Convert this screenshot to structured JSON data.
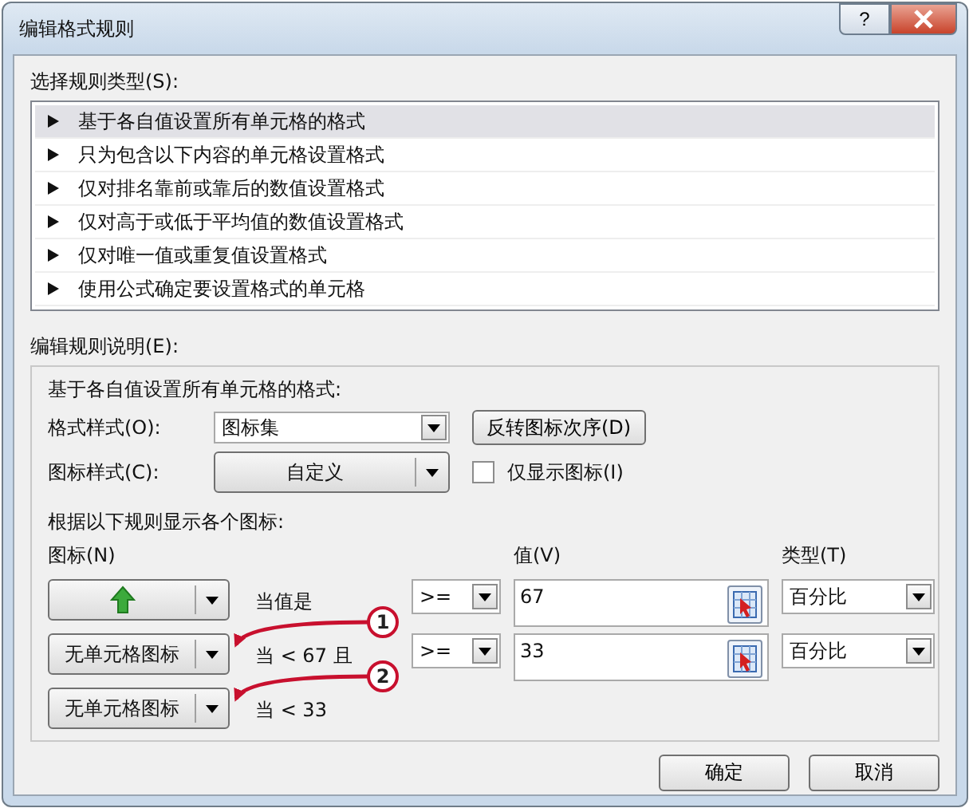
{
  "window": {
    "title": "编辑格式规则",
    "help_button": "?"
  },
  "rule_type": {
    "label": "选择规则类型(S):",
    "items": [
      {
        "label": "基于各自值设置所有单元格的格式",
        "selected": true
      },
      {
        "label": "只为包含以下内容的单元格设置格式",
        "selected": false
      },
      {
        "label": "仅对排名靠前或靠后的数值设置格式",
        "selected": false
      },
      {
        "label": "仅对高于或低于平均值的数值设置格式",
        "selected": false
      },
      {
        "label": "仅对唯一值或重复值设置格式",
        "selected": false
      },
      {
        "label": "使用公式确定要设置格式的单元格",
        "selected": false
      }
    ]
  },
  "description": {
    "label": "编辑规则说明(E):",
    "heading": "基于各自值设置所有单元格的格式:",
    "format_style": {
      "label": "格式样式(O):",
      "value": "图标集"
    },
    "reverse_button": "反转图标次序(D)",
    "icon_style": {
      "label": "图标样式(C):",
      "value": "自定义"
    },
    "show_icon_only": {
      "label": "仅显示图标(I)",
      "checked": false
    },
    "rules_heading": "根据以下规则显示各个图标:",
    "columns": {
      "icon": "图标(N)",
      "value": "值(V)",
      "type": "类型(T)"
    },
    "rules": [
      {
        "icon": {
          "kind": "arrow"
        },
        "condition": "当值是",
        "operator": ">=",
        "value": "67",
        "type": "百分比"
      },
      {
        "icon": {
          "kind": "text",
          "label": "无单元格图标"
        },
        "condition": "当 < 67 且",
        "operator": ">=",
        "value": "33",
        "type": "百分比"
      },
      {
        "icon": {
          "kind": "text",
          "label": "无单元格图标"
        },
        "condition": "当 < 33"
      }
    ]
  },
  "callouts": [
    {
      "number": "1"
    },
    {
      "number": "2"
    }
  ],
  "buttons": [
    {
      "label": "确定"
    },
    {
      "label": "取消"
    }
  ]
}
